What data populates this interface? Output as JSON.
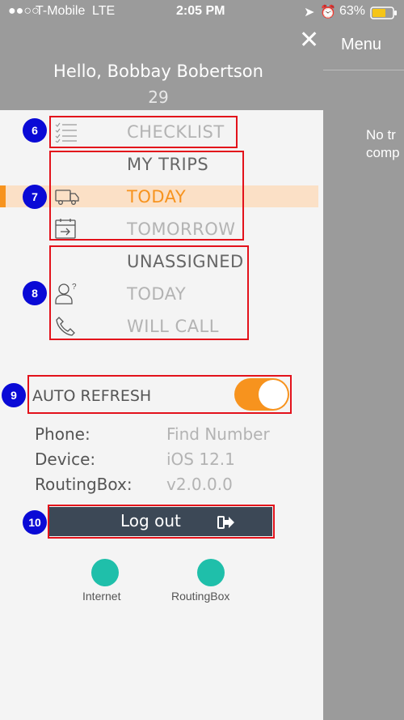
{
  "status": {
    "carrier": "T-Mobile",
    "network": "LTE",
    "time": "2:05 PM",
    "battery": "63%"
  },
  "header": {
    "greeting": "Hello, Bobbay Bobertson",
    "count": "29"
  },
  "right": {
    "menu": "Menu",
    "notrips_line1": "No tr",
    "notrips_line2": "comp"
  },
  "menu": {
    "checklist": "CHECKLIST",
    "my_trips": "MY TRIPS",
    "today": "TODAY",
    "tomorrow": "TOMORROW",
    "unassigned": "UNASSIGNED",
    "unassigned_today": "TODAY",
    "will_call": "WILL CALL"
  },
  "annotations": {
    "a6": "6",
    "a7": "7",
    "a8": "8",
    "a9": "9",
    "a10": "10"
  },
  "auto_refresh": {
    "label": "AUTO REFRESH",
    "enabled": true
  },
  "info": {
    "phone_key": "Phone:",
    "phone_val": "Find Number",
    "device_key": "Device:",
    "device_val": "iOS 12.1",
    "routingbox_key": "RoutingBox:",
    "routingbox_val": "v2.0.0.0"
  },
  "logout": {
    "label": "Log out"
  },
  "connection": {
    "internet": "Internet",
    "routingbox": "RoutingBox"
  },
  "colors": {
    "accent": "#f7931e",
    "status_ok": "#1fbfaa",
    "logout_bg": "#3c4856",
    "annotation_box": "#e3121b"
  }
}
